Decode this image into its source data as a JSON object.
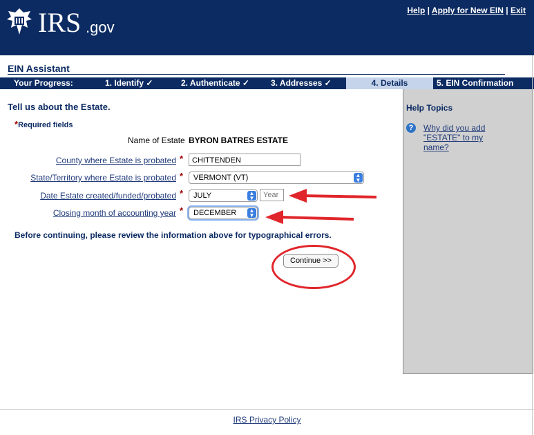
{
  "header": {
    "logo_main": "IRS",
    "logo_suffix": ".gov",
    "links": {
      "help": "Help",
      "apply": "Apply for New EIN",
      "exit": "Exit",
      "separator": "|"
    }
  },
  "app_title": "EIN Assistant",
  "progress": {
    "label": "Your Progress:",
    "steps": [
      {
        "label": "1. Identify",
        "done": true
      },
      {
        "label": "2. Authenticate",
        "done": true
      },
      {
        "label": "3. Addresses",
        "done": true
      },
      {
        "label": "4. Details",
        "active": true
      },
      {
        "label": "5. EIN Confirmation"
      }
    ],
    "checkmark": "✓"
  },
  "main": {
    "heading": "Tell us about the Estate.",
    "required_note": "Required fields",
    "required_star": "*",
    "name_label": "Name of Estate",
    "name_value": "BYRON BATRES ESTATE",
    "fields": {
      "county": {
        "label": "County where Estate is probated",
        "value": "CHITTENDEN"
      },
      "state": {
        "label": "State/Territory where Estate is probated",
        "value": "VERMONT (VT)"
      },
      "date": {
        "label": "Date Estate created/funded/probated",
        "month": "JULY",
        "year_placeholder": "Year"
      },
      "closing": {
        "label": "Closing month of accounting year",
        "value": "DECEMBER"
      }
    },
    "review_note": "Before continuing, please review the information above for typographical errors.",
    "continue_label": "Continue >>"
  },
  "sidebar": {
    "title": "Help Topics",
    "help_link": "Why did you add \"ESTATE\" to my name?",
    "help_icon": "?"
  },
  "footer": {
    "privacy": "IRS Privacy Policy"
  },
  "colors": {
    "navy": "#0c2b63",
    "annotation_red": "#e0262b",
    "active_step": "#c5d4ea"
  }
}
